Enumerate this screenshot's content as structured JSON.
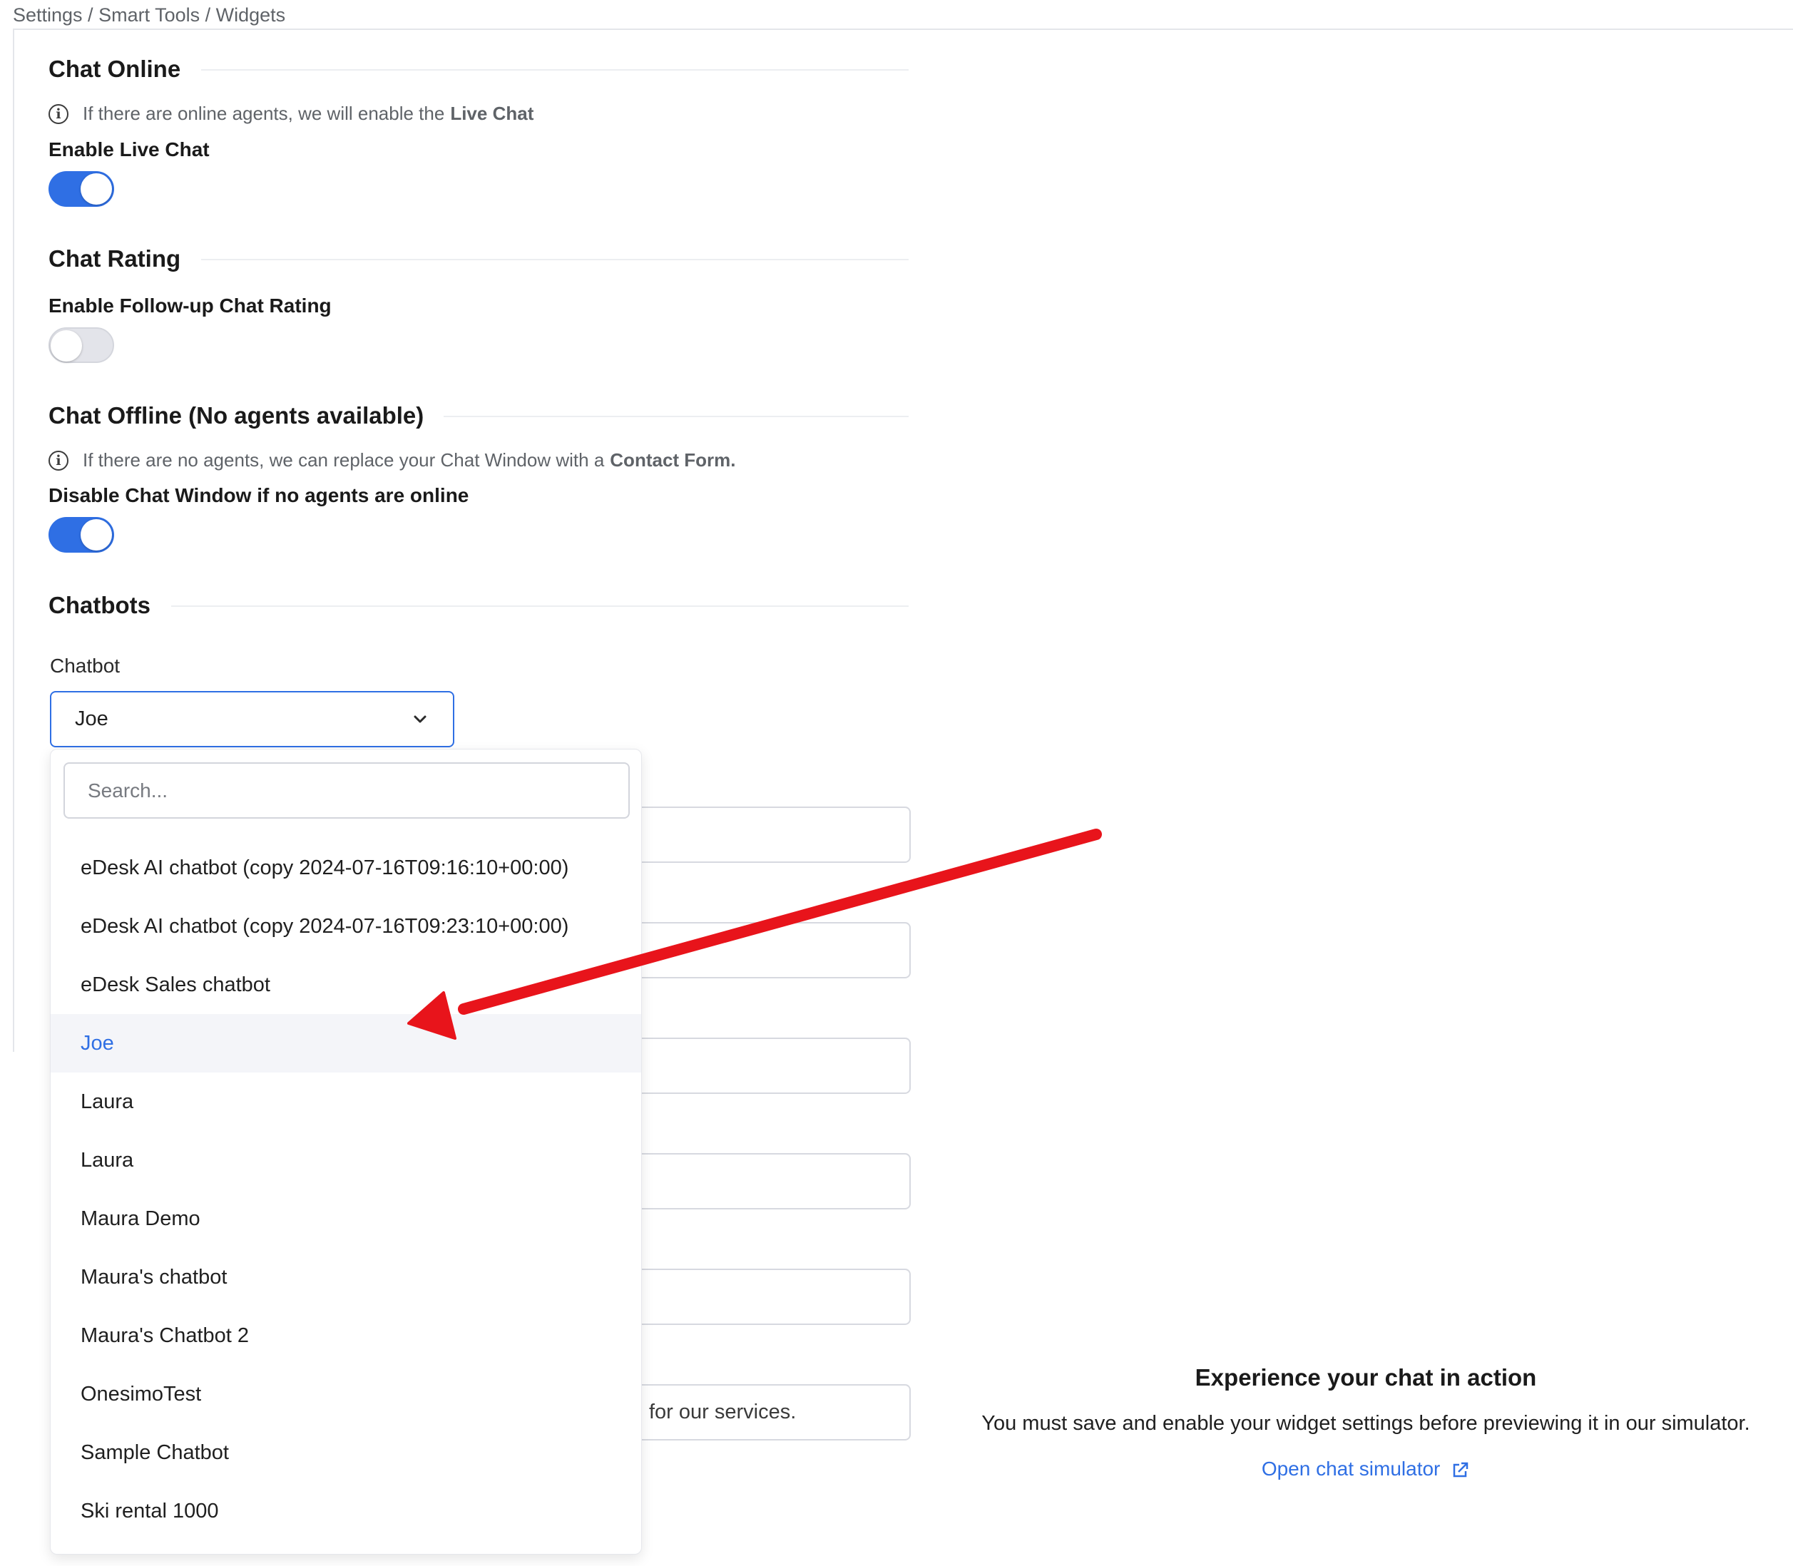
{
  "breadcrumb": "Settings / Smart Tools / Widgets",
  "chat_online": {
    "title": "Chat Online",
    "info_text": "If there are online agents, we will enable the",
    "info_bold": "Live Chat",
    "toggle_label": "Enable Live Chat",
    "toggle_on": true
  },
  "chat_rating": {
    "title": "Chat Rating",
    "toggle_label": "Enable Follow-up Chat Rating",
    "toggle_on": false
  },
  "chat_offline": {
    "title": "Chat Offline (No agents available)",
    "info_text": "If there are no agents, we can replace your Chat Window with a",
    "info_bold": "Contact Form.",
    "toggle_label": "Disable Chat Window if no agents are online",
    "toggle_on": true
  },
  "chatbots": {
    "title": "Chatbots",
    "chatbot_label": "Chatbot",
    "selected": "Joe"
  },
  "dropdown": {
    "search_placeholder": "Search...",
    "options": [
      "eDesk AI chatbot (copy 2024-07-16T09:16:10+00:00)",
      "eDesk AI chatbot (copy 2024-07-16T09:23:10+00:00)",
      "eDesk Sales chatbot",
      "Joe",
      "Laura",
      "Laura",
      "Maura Demo",
      "Maura's chatbot",
      "Maura's Chatbot 2",
      "OnesimoTest",
      "Sample Chatbot",
      "Ski rental 1000"
    ]
  },
  "background_field_text": "for our services.",
  "preview": {
    "title": "Experience your chat in action",
    "text": "You must save and enable your widget settings before previewing it in our simulator.",
    "link": "Open chat simulator"
  },
  "colors": {
    "accent": "#2f6fe4",
    "annotation_arrow": "#e8141b"
  },
  "icons": [
    "info-icon",
    "chevron-down-icon",
    "external-link-icon"
  ]
}
